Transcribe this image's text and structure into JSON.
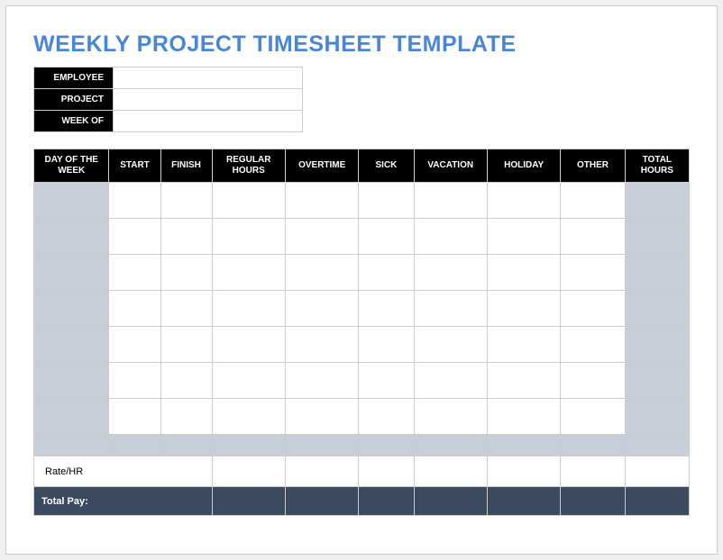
{
  "title": "WEEKLY PROJECT TIMESHEET TEMPLATE",
  "info": {
    "employee_label": "EMPLOYEE",
    "employee_value": "",
    "project_label": "PROJECT",
    "project_value": "",
    "weekof_label": "WEEK OF",
    "weekof_value": ""
  },
  "columns": {
    "day": "DAY OF THE WEEK",
    "start": "START",
    "finish": "FINISH",
    "regular": "REGULAR HOURS",
    "overtime": "OVERTIME",
    "sick": "SICK",
    "vacation": "VACATION",
    "holiday": "HOLIDAY",
    "other": "OTHER",
    "total": "TOTAL HOURS"
  },
  "rows": [
    {
      "day": "",
      "start": "",
      "finish": "",
      "regular": "",
      "overtime": "",
      "sick": "",
      "vacation": "",
      "holiday": "",
      "other": "",
      "total": ""
    },
    {
      "day": "",
      "start": "",
      "finish": "",
      "regular": "",
      "overtime": "",
      "sick": "",
      "vacation": "",
      "holiday": "",
      "other": "",
      "total": ""
    },
    {
      "day": "",
      "start": "",
      "finish": "",
      "regular": "",
      "overtime": "",
      "sick": "",
      "vacation": "",
      "holiday": "",
      "other": "",
      "total": ""
    },
    {
      "day": "",
      "start": "",
      "finish": "",
      "regular": "",
      "overtime": "",
      "sick": "",
      "vacation": "",
      "holiday": "",
      "other": "",
      "total": ""
    },
    {
      "day": "",
      "start": "",
      "finish": "",
      "regular": "",
      "overtime": "",
      "sick": "",
      "vacation": "",
      "holiday": "",
      "other": "",
      "total": ""
    },
    {
      "day": "",
      "start": "",
      "finish": "",
      "regular": "",
      "overtime": "",
      "sick": "",
      "vacation": "",
      "holiday": "",
      "other": "",
      "total": ""
    },
    {
      "day": "",
      "start": "",
      "finish": "",
      "regular": "",
      "overtime": "",
      "sick": "",
      "vacation": "",
      "holiday": "",
      "other": "",
      "total": ""
    }
  ],
  "subtotal": {
    "day": "",
    "start": "",
    "finish": "",
    "regular": "",
    "overtime": "",
    "sick": "",
    "vacation": "",
    "holiday": "",
    "other": "",
    "total": ""
  },
  "rate": {
    "label": "Rate/HR",
    "regular": "",
    "overtime": "",
    "sick": "",
    "vacation": "",
    "holiday": "",
    "other": "",
    "total": ""
  },
  "totalpay": {
    "label": "Total Pay:",
    "regular": "",
    "overtime": "",
    "sick": "",
    "vacation": "",
    "holiday": "",
    "other": "",
    "total": ""
  }
}
